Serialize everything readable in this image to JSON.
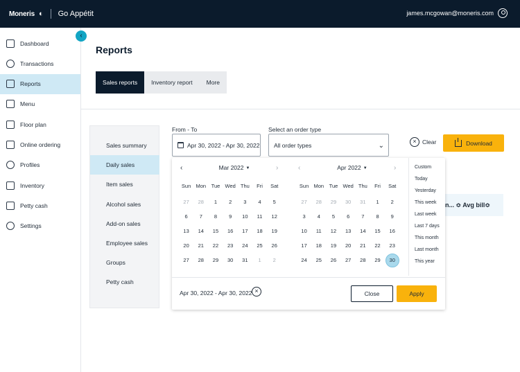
{
  "header": {
    "brand": "Moneris",
    "product": "Go Appétit",
    "user_email": "james.mcgowan@moneris.com",
    "user_icon": "user-circle-icon"
  },
  "sidebar": {
    "items": [
      {
        "label": "Dashboard",
        "icon": "dashboard-icon"
      },
      {
        "label": "Transactions",
        "icon": "transactions-icon"
      },
      {
        "label": "Reports",
        "icon": "reports-icon",
        "active": true
      },
      {
        "label": "Menu",
        "icon": "menu-icon"
      },
      {
        "label": "Floor plan",
        "icon": "floor-plan-icon"
      },
      {
        "label": "Online ordering",
        "icon": "online-ordering-icon"
      },
      {
        "label": "Profiles",
        "icon": "profiles-icon"
      },
      {
        "label": "Inventory",
        "icon": "inventory-icon"
      },
      {
        "label": "Petty cash",
        "icon": "petty-cash-icon"
      },
      {
        "label": "Settings",
        "icon": "settings-icon"
      }
    ],
    "collapse_glyph": "‹"
  },
  "page": {
    "title": "Reports",
    "tabs": [
      {
        "label": "Sales reports",
        "active": true
      },
      {
        "label": "Inventory report"
      },
      {
        "label": "More"
      }
    ]
  },
  "report_types": [
    {
      "label": "Sales summary"
    },
    {
      "label": "Daily sales",
      "active": true
    },
    {
      "label": "Item sales"
    },
    {
      "label": "Alcohol sales"
    },
    {
      "label": "Add-on sales"
    },
    {
      "label": "Employee sales"
    },
    {
      "label": "Groups"
    },
    {
      "label": "Petty cash"
    }
  ],
  "filters": {
    "date_label": "From - To",
    "date_value": "Apr 30, 2022 - Apr 30, 2022",
    "order_type_label": "Select an order type",
    "order_type_value": "All order types",
    "clear_label": "Clear",
    "download_label": "Download"
  },
  "table_header_partial": "n... ≎ Avg bill≎",
  "datepicker": {
    "weekdays": [
      "Sun",
      "Mon",
      "Tue",
      "Wed",
      "Thu",
      "Fri",
      "Sat"
    ],
    "months": [
      {
        "title": "Mar 2022",
        "weeks": [
          [
            "27",
            "28",
            "1",
            "2",
            "3",
            "4",
            "5"
          ],
          [
            "6",
            "7",
            "8",
            "9",
            "10",
            "11",
            "12"
          ],
          [
            "13",
            "14",
            "15",
            "16",
            "17",
            "18",
            "19"
          ],
          [
            "20",
            "21",
            "22",
            "23",
            "24",
            "25",
            "26"
          ],
          [
            "27",
            "28",
            "29",
            "30",
            "31",
            "1",
            "2"
          ]
        ],
        "muted": [
          [
            0,
            0
          ],
          [
            0,
            1
          ],
          [
            4,
            5
          ],
          [
            4,
            6
          ]
        ]
      },
      {
        "title": "Apr 2022",
        "weeks": [
          [
            "27",
            "28",
            "29",
            "30",
            "31",
            "1",
            "2"
          ],
          [
            "3",
            "4",
            "5",
            "6",
            "7",
            "8",
            "9"
          ],
          [
            "10",
            "11",
            "12",
            "13",
            "14",
            "15",
            "16"
          ],
          [
            "17",
            "18",
            "19",
            "20",
            "21",
            "22",
            "23"
          ],
          [
            "24",
            "25",
            "26",
            "27",
            "28",
            "29",
            "30"
          ]
        ],
        "muted": [
          [
            0,
            0
          ],
          [
            0,
            1
          ],
          [
            0,
            2
          ],
          [
            0,
            3
          ],
          [
            0,
            4
          ]
        ],
        "selected": [
          4,
          6
        ]
      }
    ],
    "presets": [
      "Custom",
      "Today",
      "Yesterday",
      "This week",
      "Last week",
      "Last 7 days",
      "This month",
      "Last month",
      "This year"
    ],
    "range_text": "Apr 30, 2022 - Apr 30, 2022",
    "close_label": "Close",
    "apply_label": "Apply"
  }
}
